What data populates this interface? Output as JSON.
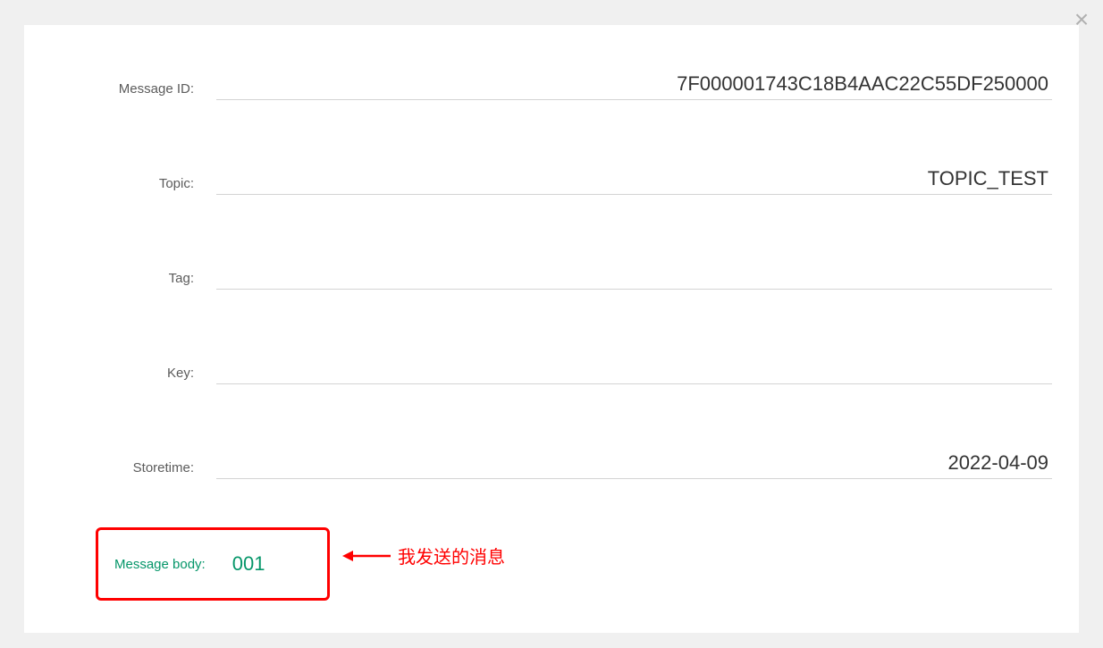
{
  "modal": {
    "close_label": "×"
  },
  "fields": {
    "message_id": {
      "label": "Message ID:",
      "value": "7F000001743C18B4AAC22C55DF250000"
    },
    "topic": {
      "label": "Topic:",
      "value": "TOPIC_TEST"
    },
    "tag": {
      "label": "Tag:",
      "value": ""
    },
    "key": {
      "label": "Key:",
      "value": ""
    },
    "storetime": {
      "label": "Storetime:",
      "value": "2022-04-09"
    },
    "message_body": {
      "label": "Message body:",
      "value": "001"
    }
  },
  "annotation": {
    "text": "我发送的消息"
  }
}
